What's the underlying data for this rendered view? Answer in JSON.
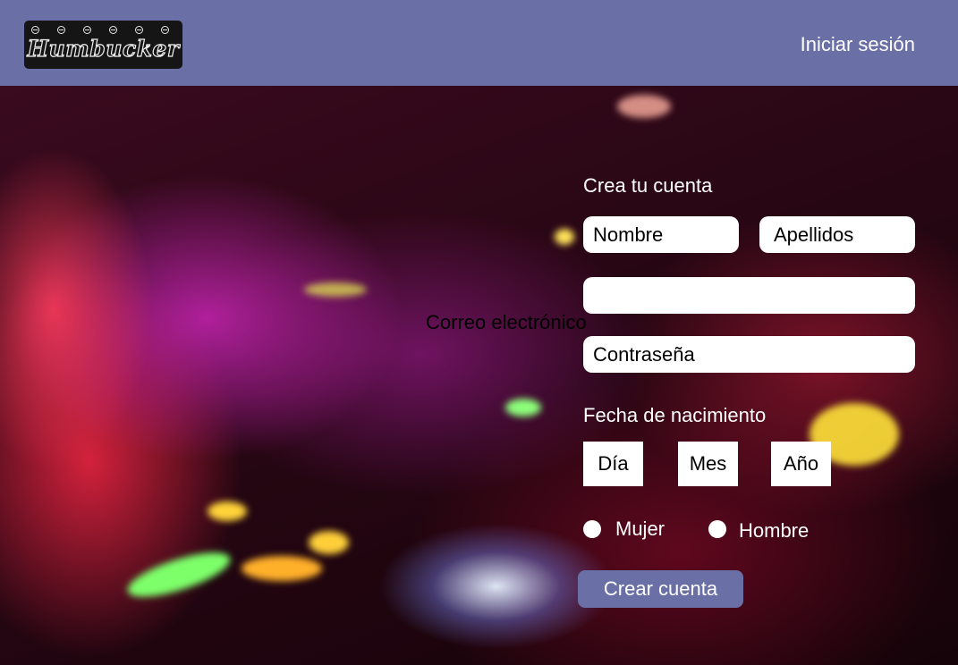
{
  "header": {
    "logo_text": "Humbucker",
    "login_label": "Iniciar sesión"
  },
  "form": {
    "title": "Crea tu cuenta",
    "first_name_placeholder": "Nombre",
    "last_name_placeholder": "Apellidos",
    "email_label": "Correo electrónico",
    "password_placeholder": "Contraseña",
    "birth_label": "Fecha de nacimiento",
    "day_label": "Día",
    "month_label": "Mes",
    "year_label": "Año",
    "gender_options": [
      "Mujer",
      "Hombre"
    ],
    "submit_label": "Crear cuenta"
  },
  "colors": {
    "header_bg": "#6a70a6",
    "button_bg": "#6a70a6"
  }
}
